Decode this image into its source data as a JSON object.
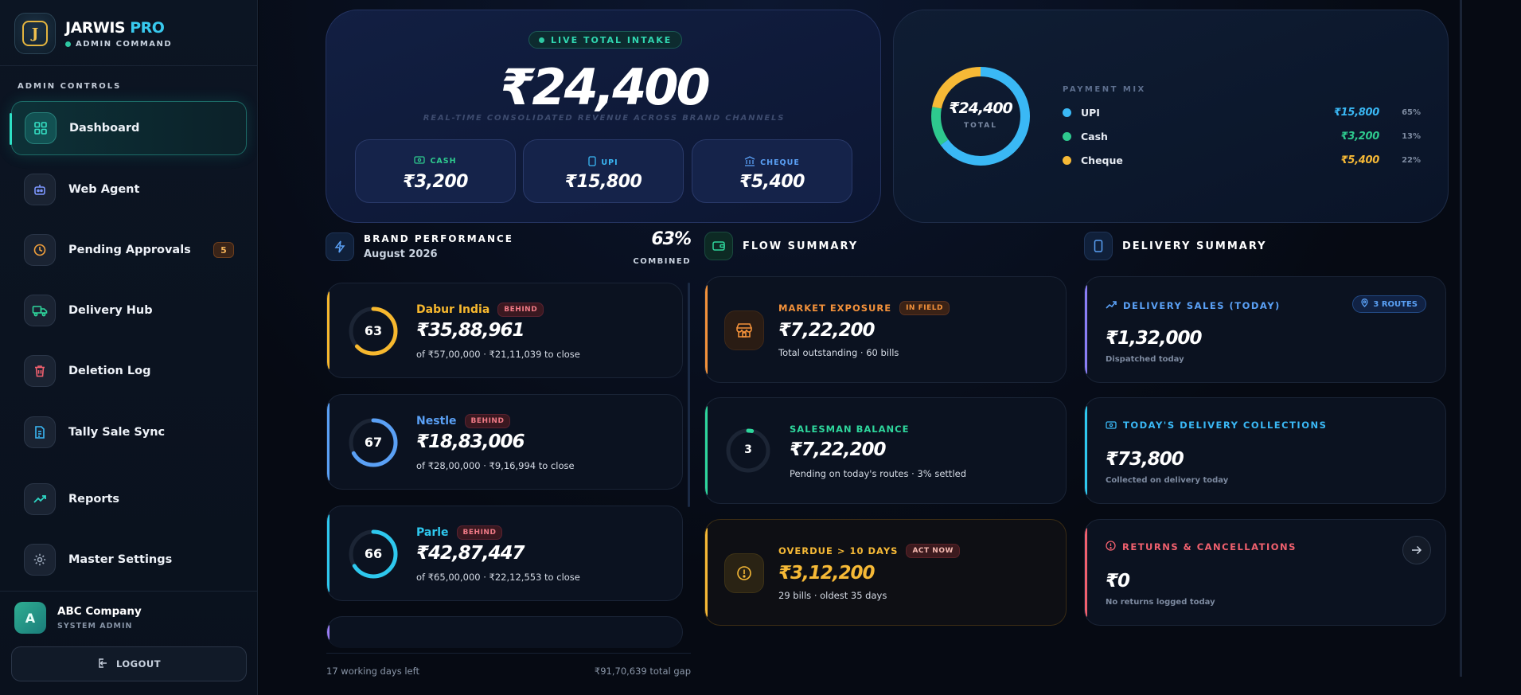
{
  "sidebar": {
    "brand_name": "JARWIS",
    "brand_pro": "PRO",
    "brand_sub": "ADMIN COMMAND",
    "logo_letter": "J",
    "section_label": "ADMIN CONTROLS",
    "items": [
      {
        "label": "Dashboard",
        "icon": "dashboard-grid-icon",
        "active": true
      },
      {
        "label": "Web Agent",
        "icon": "robot-icon"
      },
      {
        "label": "Pending Approvals",
        "icon": "clock-icon",
        "badge": "5"
      },
      {
        "label": "Delivery Hub",
        "icon": "truck-icon"
      },
      {
        "label": "Deletion Log",
        "icon": "trash-icon"
      },
      {
        "label": "Tally Sale Sync",
        "icon": "document-sync-icon"
      },
      {
        "label": "Reports",
        "icon": "trending-up-icon"
      },
      {
        "label": "Master Settings",
        "icon": "gear-icon"
      }
    ],
    "user": {
      "initial": "A",
      "name": "ABC Company",
      "role": "SYSTEM ADMIN"
    },
    "logout_label": "LOGOUT"
  },
  "hero": {
    "live_label": "LIVE TOTAL INTAKE",
    "total": "₹24,400",
    "subtitle": "REAL-TIME CONSOLIDATED REVENUE ACROSS BRAND CHANNELS",
    "cash": {
      "label": "CASH",
      "value": "₹3,200"
    },
    "upi": {
      "label": "UPI",
      "value": "₹15,800"
    },
    "cheque": {
      "label": "CHEQUE",
      "value": "₹5,400"
    }
  },
  "payment_mix": {
    "title": "PAYMENT MIX",
    "center_value": "₹24,400",
    "center_label": "TOTAL",
    "rows": [
      {
        "name": "UPI",
        "amount": "₹15,800",
        "pct": "65%",
        "color": "#3ab8f5",
        "fraction": 0.65
      },
      {
        "name": "Cash",
        "amount": "₹3,200",
        "pct": "13%",
        "color": "#2ec98e",
        "fraction": 0.13
      },
      {
        "name": "Cheque",
        "amount": "₹5,400",
        "pct": "22%",
        "color": "#f6b936",
        "fraction": 0.22
      }
    ]
  },
  "brand_performance": {
    "title": "BRAND PERFORMANCE",
    "period": "August 2026",
    "combined_pct": "63%",
    "combined_label": "COMBINED",
    "brands": [
      {
        "name": "Dabur India",
        "tag": "BEHIND",
        "score": "63",
        "value": "₹35,88,961",
        "sub": "of ₹57,00,000 · ₹21,11,039 to close",
        "color": "#f7b82e",
        "fraction": 0.63
      },
      {
        "name": "Nestle",
        "tag": "BEHIND",
        "score": "67",
        "value": "₹18,83,006",
        "sub": "of ₹28,00,000 · ₹9,16,994 to close",
        "color": "#5aa0f5",
        "fraction": 0.67
      },
      {
        "name": "Parle",
        "tag": "BEHIND",
        "score": "66",
        "value": "₹42,87,447",
        "sub": "of ₹65,00,000 · ₹22,12,553 to close",
        "color": "#2ec8ee",
        "fraction": 0.66
      }
    ],
    "footer_left": "17 working days left",
    "footer_right": "₹91,70,639 total gap"
  },
  "flow_summary": {
    "title": "FLOW SUMMARY",
    "market": {
      "label": "MARKET EXPOSURE",
      "tag": "IN FIELD",
      "value": "₹7,22,200",
      "sub": "Total outstanding · 60 bills"
    },
    "salesman": {
      "label": "SALESMAN BALANCE",
      "count": "3",
      "value": "₹7,22,200",
      "sub": "Pending on today's routes · 3% settled",
      "fraction": 0.03
    },
    "overdue": {
      "label": "OVERDUE > 10 DAYS",
      "tag": "ACT NOW",
      "value": "₹3,12,200",
      "sub": "29 bills · oldest 35 days"
    }
  },
  "delivery_summary": {
    "title": "DELIVERY SUMMARY",
    "sales": {
      "label": "DELIVERY SALES (TODAY)",
      "routes": "3 ROUTES",
      "value": "₹1,32,000",
      "sub": "Dispatched today"
    },
    "collections": {
      "label": "TODAY'S DELIVERY COLLECTIONS",
      "value": "₹73,800",
      "sub": "Collected on delivery today"
    },
    "returns": {
      "label": "RETURNS & CANCELLATIONS",
      "value": "₹0",
      "sub": "No returns logged today"
    }
  }
}
